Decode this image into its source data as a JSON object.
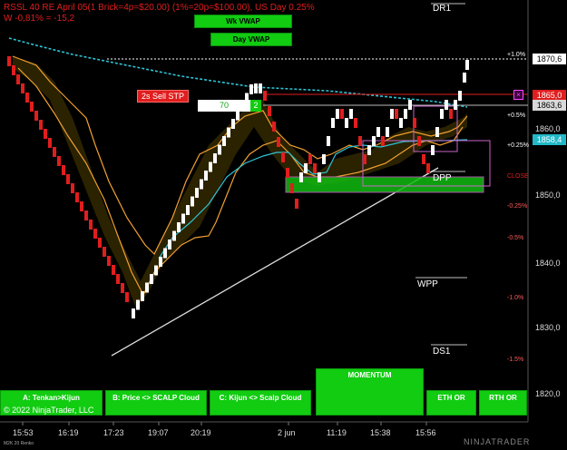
{
  "header": {
    "title": "RSSL 40 RE April 05(1 Brick=4p=$20.00) (1%=20p=$100.00), US Day 0.25%",
    "subtitle": "W -0,81% = -15,2"
  },
  "vwap_buttons": {
    "wk": "Wk VWAP",
    "day": "Day VWAP"
  },
  "order": {
    "stp_label": "2s Sell STP",
    "qty": "70",
    "count": "2",
    "close": "×"
  },
  "levels": {
    "dr1": "DR1",
    "dpp": "DPP",
    "wpp": "WPP",
    "ds1": "DS1"
  },
  "price_tags": [
    {
      "text": "1870,6",
      "bg": "#ffffff",
      "fg": "#000000"
    },
    {
      "text": "1865,0",
      "bg": "#e01e1e",
      "fg": "#ffffff"
    },
    {
      "text": "1863,6",
      "bg": "#d9d9d9",
      "fg": "#000000"
    },
    {
      "text": "1858,4",
      "bg": "#22b8c8",
      "fg": "#ffffff"
    }
  ],
  "price_axis": [
    "1860,0",
    "1850,0",
    "1840,0",
    "1830,0",
    "1820,0"
  ],
  "pct_axis": [
    {
      "text": "+1.0%",
      "color": "#ffffff"
    },
    {
      "text": "+0.5%",
      "color": "#ffffff"
    },
    {
      "text": "+0.25%",
      "color": "#ffffff"
    },
    {
      "text": "CLOSE",
      "color": "#e01e1e"
    },
    {
      "text": "-0.25%",
      "color": "#ff5a5a"
    },
    {
      "text": "-0.5%",
      "color": "#ff5a5a"
    },
    {
      "text": "-1.0%",
      "color": "#ff5a5a"
    },
    {
      "text": "-1.5%",
      "color": "#ff5a5a"
    }
  ],
  "time_axis": [
    "15:53",
    "16:19",
    "17:23",
    "19:07",
    "20:19",
    "2 jun",
    "11:19",
    "15:38",
    "15:56"
  ],
  "buttons": {
    "tenkan": "A: Tenkan>Kijun",
    "price_scalp": "B: Price <> SCALP Cloud",
    "kijun_scalp": "C: Kijun <> Scalp Cloud",
    "momentum": "MOMENTUM",
    "eth": "ETH OR",
    "rth": "RTH OR"
  },
  "footer": {
    "copyright": "© 2022 NinjaTrader, LLC",
    "chart_id": "M2K 20 Renko",
    "logo": "NINJATRADER"
  },
  "colors": {
    "up": "#ffffff",
    "down": "#e01e1e",
    "cyan": "#2ec4d6",
    "orange": "#f0a030",
    "green_zone": "#11bb11",
    "accent": "#11cc11"
  }
}
